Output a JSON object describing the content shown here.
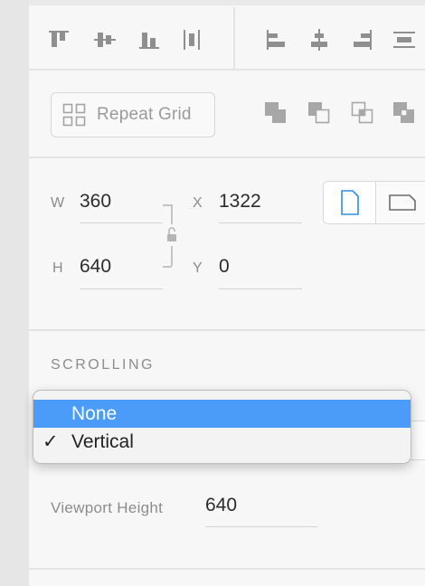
{
  "toolbar": {
    "align_icons": [
      "align-top-icon",
      "align-middle-vertical-icon",
      "align-bottom-icon",
      "distribute-horizontal-icon",
      "align-left-icon",
      "align-center-horizontal-icon",
      "align-right-icon",
      "distribute-vertical-icon"
    ],
    "boolean_icons": [
      "boolean-add-icon",
      "boolean-subtract-icon",
      "boolean-intersect-icon",
      "boolean-exclude-icon"
    ]
  },
  "repeat_grid": {
    "label": "Repeat Grid"
  },
  "transform": {
    "w_label": "W",
    "w_value": "360",
    "h_label": "H",
    "h_value": "640",
    "x_label": "X",
    "x_value": "1322",
    "y_label": "Y",
    "y_value": "0"
  },
  "orientation": {
    "selected": "portrait"
  },
  "scrolling": {
    "title": "SCROLLING",
    "options": [
      {
        "label": "None",
        "highlighted": true,
        "checked": false
      },
      {
        "label": "Vertical",
        "highlighted": false,
        "checked": true
      }
    ],
    "check_mark": "✓",
    "viewport_label": "Viewport Height",
    "viewport_value": "640"
  },
  "colors": {
    "highlight": "#4a9cf8",
    "accent_icon": "#2f8de4",
    "panel_bg": "#f7f7f7"
  }
}
